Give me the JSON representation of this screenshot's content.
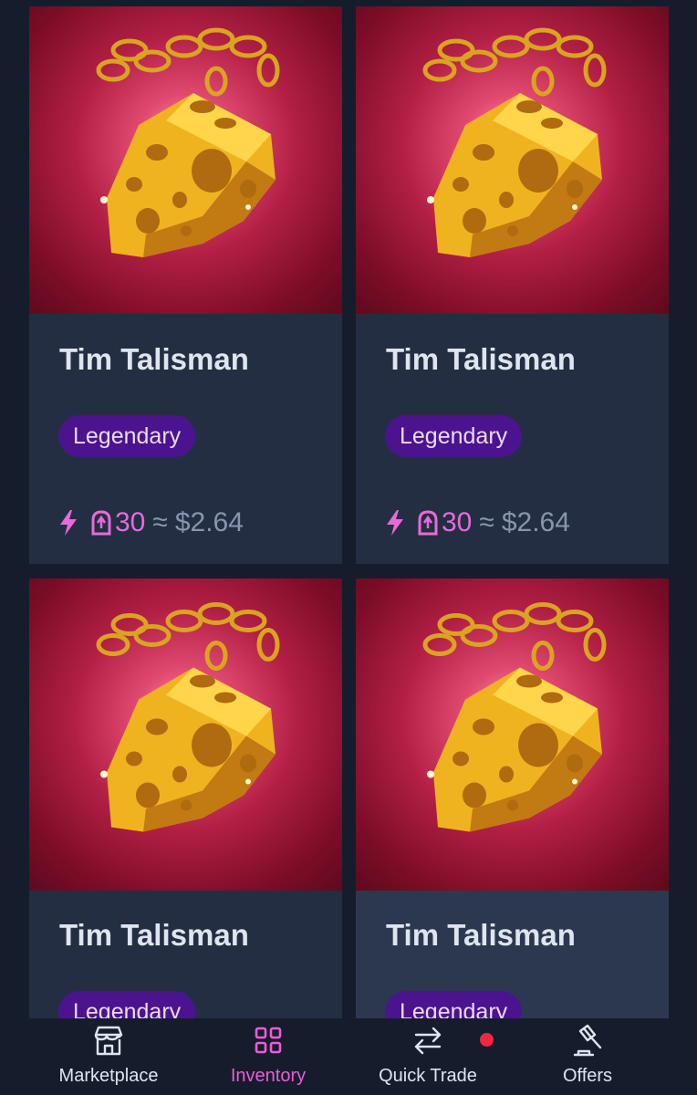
{
  "colors": {
    "page_bg": "#151d2c",
    "card_bg": "#232e43",
    "card_bg_selected": "#2c3850",
    "badge_bg": "#4c138f",
    "accent": "#ee5bd9",
    "art_bg": "#b21f45",
    "notification": "#f0283f"
  },
  "items": [
    {
      "title": "Tim Talisman",
      "rarity": "Legendary",
      "price_icon": "bolt-icon",
      "currency_icon": "coin-icon",
      "amount": "30",
      "approx": "≈",
      "usd": "$2.64"
    },
    {
      "title": "Tim Talisman",
      "rarity": "Legendary",
      "price_icon": "bolt-icon",
      "currency_icon": "coin-icon",
      "amount": "30",
      "approx": "≈",
      "usd": "$2.64"
    },
    {
      "title": "Tim Talisman",
      "rarity": "Legendary"
    },
    {
      "title": "Tim Talisman",
      "rarity": "Legendary"
    }
  ],
  "nav": {
    "items": [
      {
        "label": "Marketplace",
        "icon": "store-icon",
        "active": false
      },
      {
        "label": "Inventory",
        "icon": "grid-icon",
        "active": true
      },
      {
        "label": "Quick Trade",
        "icon": "swap-arrows-icon",
        "active": false,
        "notification": true
      },
      {
        "label": "Offers",
        "icon": "gavel-icon",
        "active": false
      }
    ]
  }
}
